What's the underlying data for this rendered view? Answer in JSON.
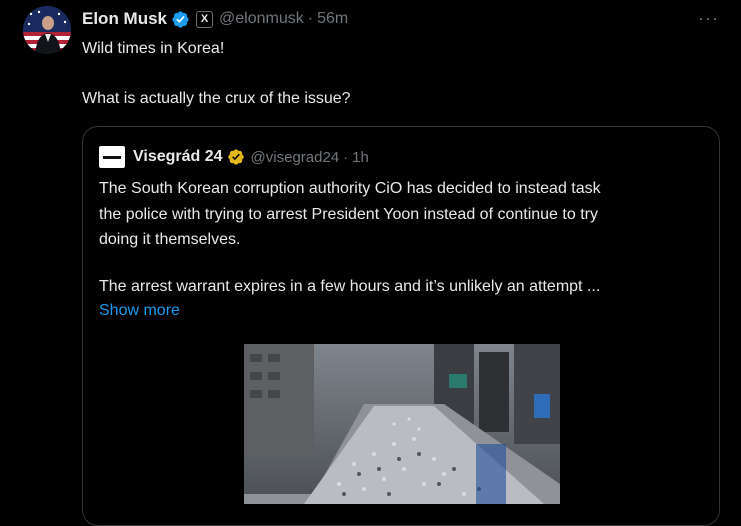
{
  "tweet": {
    "author_name": "Elon Musk",
    "affiliation_badge": "X",
    "handle": "@elonmusk",
    "separator": "·",
    "time": "56m",
    "more_label": "···",
    "lines": [
      "Wild times in Korea!",
      "What is actually the crux of the issue?"
    ]
  },
  "quote": {
    "author_name": "Visegrád 24",
    "handle": "@visegrad24",
    "separator": "·",
    "time": "1h",
    "lines": [
      "The South Korean corruption authority CiO has decided to instead task",
      "the police with trying to arrest President Yoon instead of continue to try",
      "doing it themselves.",
      "The arrest warrant expires in a few hours and it’s unlikely an attempt ..."
    ],
    "show_more": "Show more"
  },
  "colors": {
    "background": "#000000",
    "text": "#e7e9ea",
    "secondary_text": "#71767b",
    "link": "#1d9bf0",
    "verified_blue": "#1d9bf0",
    "verified_gold": "#e2b719",
    "border": "#2f3336"
  },
  "icons": {
    "verified_blue": "verified-badge-icon",
    "verified_gold": "gold-verified-badge-icon",
    "affiliation": "x-logo-icon",
    "more": "more-options-icon"
  }
}
